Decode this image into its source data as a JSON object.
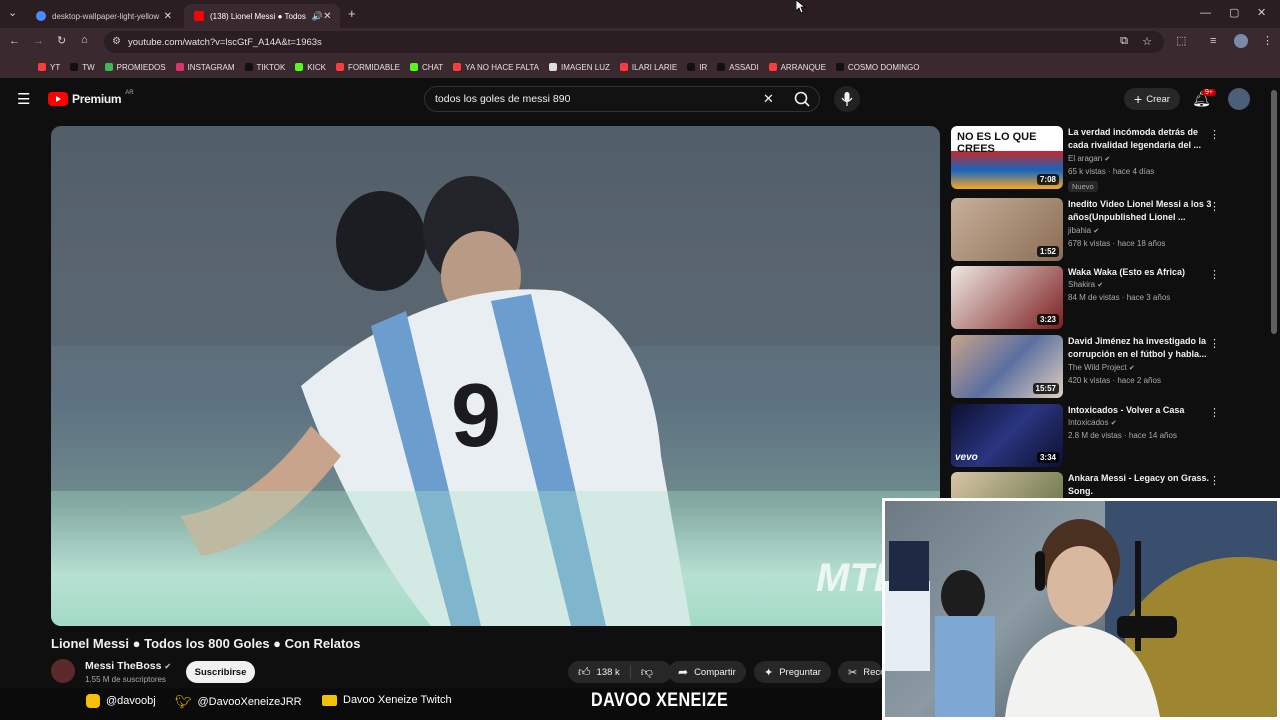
{
  "browser": {
    "tabs": [
      {
        "label": "desktop-wallpaper-light-yellow",
        "active": false
      },
      {
        "label": "(138) Lionel Messi ● Todos",
        "active": true
      }
    ],
    "url": "youtube.com/watch?v=lscGtF_A14A&t=1963s",
    "bookmarks": [
      "YT",
      "TW",
      "PROMIEDOS",
      "INSTAGRAM",
      "TIKTOK",
      "KICK",
      "FORMIDABLE",
      "CHAT",
      "YA NO HACE FALTA",
      "IMAGEN LUZ",
      "ILARI LARIE",
      "IR",
      "ASSADI",
      "ARRANQUE",
      "COSMO DOMINGO"
    ]
  },
  "youtube": {
    "logo": "Premium",
    "logo_region": "AR",
    "search_value": "todos los goles de messi 890",
    "create_label": "Crear",
    "notif_count": "9+"
  },
  "video": {
    "title": "Lionel Messi ● Todos los 800 Goles ● Con Relatos",
    "channel": "Messi TheBoss",
    "subscribers": "1.55 M de suscriptores",
    "subscribe_label": "Suscribirse",
    "likes": "138 k",
    "share_label": "Compartir",
    "ask_label": "Preguntar",
    "clip_label": "Recor",
    "jersey_number": "9",
    "watermark": "MTB"
  },
  "recommendations": [
    {
      "title": "La verdad incómoda detrás de cada rivalidad legendaria del ...",
      "channel": "El aragan",
      "meta": "65 k vistas · hace 4 días",
      "badge": "Nuevo",
      "duration": "7:08",
      "thumb_text": "NO ES LO QUE CREES"
    },
    {
      "title": "Inedito Video Lionel Messi a los 3 años(Unpublished Lionel ...",
      "channel": "jibahia",
      "meta": "678 k vistas · hace 18 años",
      "duration": "1:52"
    },
    {
      "title": "Waka Waka (Esto es Africa)",
      "channel": "Shakira",
      "meta": "84 M de vistas · hace 3 años",
      "duration": "3:23"
    },
    {
      "title": "David Jiménez ha investigado la corrupción en el fútbol y habla...",
      "channel": "The Wild Project",
      "meta": "420 k vistas · hace 2 años",
      "duration": "15:57"
    },
    {
      "title": "Intoxicados - Volver a Casa",
      "channel": "Intoxicados",
      "meta": "2.8 M de vistas · hace 14 años",
      "duration": "3:34",
      "thumb_text": "vevo"
    },
    {
      "title": "Ankara Messi - Legacy on Grass. Song.",
      "channel": "",
      "meta": "",
      "duration": ""
    }
  ],
  "overlay": {
    "instagram": "@davoobj",
    "twitter": "@DavooXeneizeJRR",
    "twitch": "Davoo Xeneize Twitch",
    "brand": "DAVOO XENEIZE"
  },
  "colors": {
    "accent": "#ff0000",
    "bg": "#0f0f0f",
    "chrome": "#3a2a30"
  }
}
